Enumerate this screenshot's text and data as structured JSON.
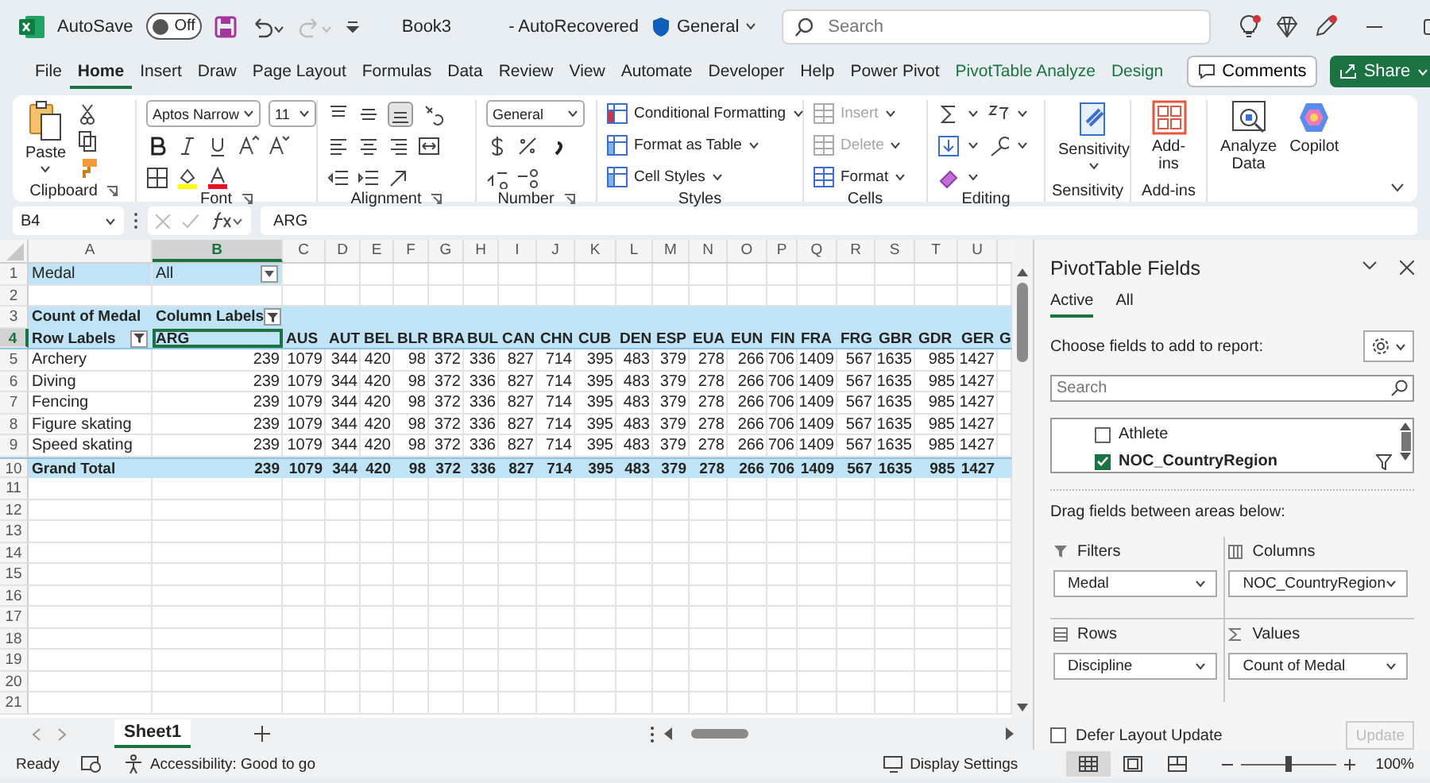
{
  "title_bar": {
    "autosave_label": "AutoSave",
    "autosave": {
      "on": false,
      "label": "Off"
    },
    "document": "Book3",
    "status": "- AutoRecovered",
    "sensitivity": "General",
    "search_placeholder": "Search"
  },
  "menu_tabs": [
    {
      "label": "File",
      "selected": false,
      "contextual": false
    },
    {
      "label": "Home",
      "selected": true,
      "contextual": false
    },
    {
      "label": "Insert",
      "selected": false,
      "contextual": false
    },
    {
      "label": "Draw",
      "selected": false,
      "contextual": false
    },
    {
      "label": "Page Layout",
      "selected": false,
      "contextual": false
    },
    {
      "label": "Formulas",
      "selected": false,
      "contextual": false
    },
    {
      "label": "Data",
      "selected": false,
      "contextual": false
    },
    {
      "label": "Review",
      "selected": false,
      "contextual": false
    },
    {
      "label": "View",
      "selected": false,
      "contextual": false
    },
    {
      "label": "Automate",
      "selected": false,
      "contextual": false
    },
    {
      "label": "Developer",
      "selected": false,
      "contextual": false
    },
    {
      "label": "Help",
      "selected": false,
      "contextual": false
    },
    {
      "label": "Power Pivot",
      "selected": false,
      "contextual": false
    },
    {
      "label": "PivotTable Analyze",
      "selected": false,
      "contextual": true
    },
    {
      "label": "Design",
      "selected": false,
      "contextual": true
    }
  ],
  "comments_button": "Comments",
  "share_button": "Share",
  "ribbon": {
    "clipboard": {
      "paste": "Paste",
      "label": "Clipboard"
    },
    "font": {
      "name": "Aptos Narrow",
      "size": "11",
      "label": "Font"
    },
    "alignment": {
      "label": "Alignment",
      "bottom_aligned": true
    },
    "number": {
      "format": "General",
      "label": "Number"
    },
    "styles": {
      "items": [
        "Conditional Formatting",
        "Format as Table",
        "Cell Styles"
      ],
      "label": "Styles"
    },
    "cells": {
      "items": [
        {
          "label": "Insert",
          "disabled": true
        },
        {
          "label": "Delete",
          "disabled": true
        },
        {
          "label": "Format",
          "disabled": false
        }
      ],
      "label": "Cells"
    },
    "editing": {
      "label": "Editing"
    },
    "sensitivity": {
      "button": "Sensitivity",
      "label": "Sensitivity"
    },
    "addins": {
      "button": "Add-ins",
      "label": "Add-ins"
    },
    "ai": {
      "analyze": "Analyze Data",
      "copilot": "Copilot"
    }
  },
  "formula_bar": {
    "name_box": "B4",
    "formula": "ARG"
  },
  "sheet": {
    "columns": [
      {
        "label": "A",
        "selected": false
      },
      {
        "label": "B",
        "selected": true
      },
      {
        "label": "C",
        "selected": false
      },
      {
        "label": "D",
        "selected": false
      },
      {
        "label": "E",
        "selected": false
      },
      {
        "label": "F",
        "selected": false
      },
      {
        "label": "G",
        "selected": false
      },
      {
        "label": "H",
        "selected": false
      },
      {
        "label": "I",
        "selected": false
      },
      {
        "label": "J",
        "selected": false
      },
      {
        "label": "K",
        "selected": false
      },
      {
        "label": "L",
        "selected": false
      },
      {
        "label": "M",
        "selected": false
      },
      {
        "label": "N",
        "selected": false
      },
      {
        "label": "O",
        "selected": false
      },
      {
        "label": "P",
        "selected": false
      },
      {
        "label": "Q",
        "selected": false
      },
      {
        "label": "R",
        "selected": false
      },
      {
        "label": "S",
        "selected": false
      },
      {
        "label": "T",
        "selected": false
      },
      {
        "label": "U",
        "selected": false
      }
    ],
    "rows": [
      {
        "number": "1",
        "selected": false,
        "kind": "filter",
        "cells": [
          "Medal",
          "All"
        ]
      },
      {
        "number": "2",
        "selected": false,
        "kind": "blank"
      },
      {
        "number": "3",
        "selected": false,
        "kind": "pivot-header",
        "cells": [
          "Count of Medal",
          "Column Labels"
        ]
      },
      {
        "number": "4",
        "selected": true,
        "kind": "pivot-labels",
        "cells": [
          "Row Labels",
          "ARG",
          "AUS",
          "AUT",
          "BEL",
          "BLR",
          "BRA",
          "BUL",
          "CAN",
          "CHN",
          "CUB",
          "DEN",
          "ESP",
          "EUA",
          "EUN",
          "FIN",
          "FRA",
          "FRG",
          "GBR",
          "GDR",
          "GER",
          "G"
        ]
      },
      {
        "number": "5",
        "selected": false,
        "kind": "data",
        "cells": [
          "Archery",
          "239",
          "1079",
          "344",
          "420",
          "98",
          "372",
          "336",
          "827",
          "714",
          "395",
          "483",
          "379",
          "278",
          "266",
          "706",
          "1409",
          "567",
          "1635",
          "985",
          "1427"
        ]
      },
      {
        "number": "6",
        "selected": false,
        "kind": "data",
        "cells": [
          "Diving",
          "239",
          "1079",
          "344",
          "420",
          "98",
          "372",
          "336",
          "827",
          "714",
          "395",
          "483",
          "379",
          "278",
          "266",
          "706",
          "1409",
          "567",
          "1635",
          "985",
          "1427"
        ]
      },
      {
        "number": "7",
        "selected": false,
        "kind": "data",
        "cells": [
          "Fencing",
          "239",
          "1079",
          "344",
          "420",
          "98",
          "372",
          "336",
          "827",
          "714",
          "395",
          "483",
          "379",
          "278",
          "266",
          "706",
          "1409",
          "567",
          "1635",
          "985",
          "1427"
        ]
      },
      {
        "number": "8",
        "selected": false,
        "kind": "data",
        "cells": [
          "Figure skating",
          "239",
          "1079",
          "344",
          "420",
          "98",
          "372",
          "336",
          "827",
          "714",
          "395",
          "483",
          "379",
          "278",
          "266",
          "706",
          "1409",
          "567",
          "1635",
          "985",
          "1427"
        ]
      },
      {
        "number": "9",
        "selected": false,
        "kind": "data",
        "cells": [
          "Speed skating",
          "239",
          "1079",
          "344",
          "420",
          "98",
          "372",
          "336",
          "827",
          "714",
          "395",
          "483",
          "379",
          "278",
          "266",
          "706",
          "1409",
          "567",
          "1635",
          "985",
          "1427"
        ]
      },
      {
        "number": "10",
        "selected": false,
        "kind": "total",
        "cells": [
          "Grand Total",
          "239",
          "1079",
          "344",
          "420",
          "98",
          "372",
          "336",
          "827",
          "714",
          "395",
          "483",
          "379",
          "278",
          "266",
          "706",
          "1409",
          "567",
          "1635",
          "985",
          "1427"
        ]
      },
      {
        "number": "11",
        "selected": false,
        "kind": "blank"
      },
      {
        "number": "12",
        "selected": false,
        "kind": "blank"
      },
      {
        "number": "13",
        "selected": false,
        "kind": "blank"
      },
      {
        "number": "14",
        "selected": false,
        "kind": "blank"
      },
      {
        "number": "15",
        "selected": false,
        "kind": "blank"
      },
      {
        "number": "16",
        "selected": false,
        "kind": "blank"
      },
      {
        "number": "17",
        "selected": false,
        "kind": "blank"
      },
      {
        "number": "18",
        "selected": false,
        "kind": "blank"
      },
      {
        "number": "19",
        "selected": false,
        "kind": "blank"
      },
      {
        "number": "20",
        "selected": false,
        "kind": "blank"
      },
      {
        "number": "21",
        "selected": false,
        "kind": "blank"
      }
    ]
  },
  "sheet_tabs": [
    {
      "label": "Sheet1",
      "selected": true
    }
  ],
  "pivot_panel": {
    "title": "PivotTable Fields",
    "tabs": [
      {
        "label": "Active",
        "selected": true
      },
      {
        "label": "All",
        "selected": false
      }
    ],
    "choose_label": "Choose fields to add to report:",
    "search_placeholder": "Search",
    "fields": [
      {
        "label": "Athlete",
        "checked": false,
        "filtered": false
      },
      {
        "label": "NOC_CountryRegion",
        "checked": true,
        "filtered": true
      }
    ],
    "drag_label": "Drag fields between areas below:",
    "areas": [
      {
        "kind": "filters",
        "label": "Filters",
        "items": [
          "Medal"
        ]
      },
      {
        "kind": "columns",
        "label": "Columns",
        "items": [
          "NOC_CountryRegion"
        ]
      },
      {
        "kind": "rows",
        "label": "Rows",
        "items": [
          "Discipline"
        ]
      },
      {
        "kind": "values",
        "label": "Values",
        "items": [
          "Count of Medal"
        ]
      }
    ],
    "defer": {
      "label": "Defer Layout Update",
      "checked": false
    },
    "update": {
      "label": "Update",
      "disabled": true
    }
  },
  "status_bar": {
    "ready": "Ready",
    "accessibility": "Accessibility: Good to go",
    "display_settings": "Display Settings",
    "views": [
      {
        "kind": "normal",
        "selected": true
      },
      {
        "kind": "page-layout",
        "selected": false
      },
      {
        "kind": "page-break",
        "selected": false
      }
    ],
    "zoom": {
      "level": 0.5,
      "reading": "100%"
    }
  }
}
